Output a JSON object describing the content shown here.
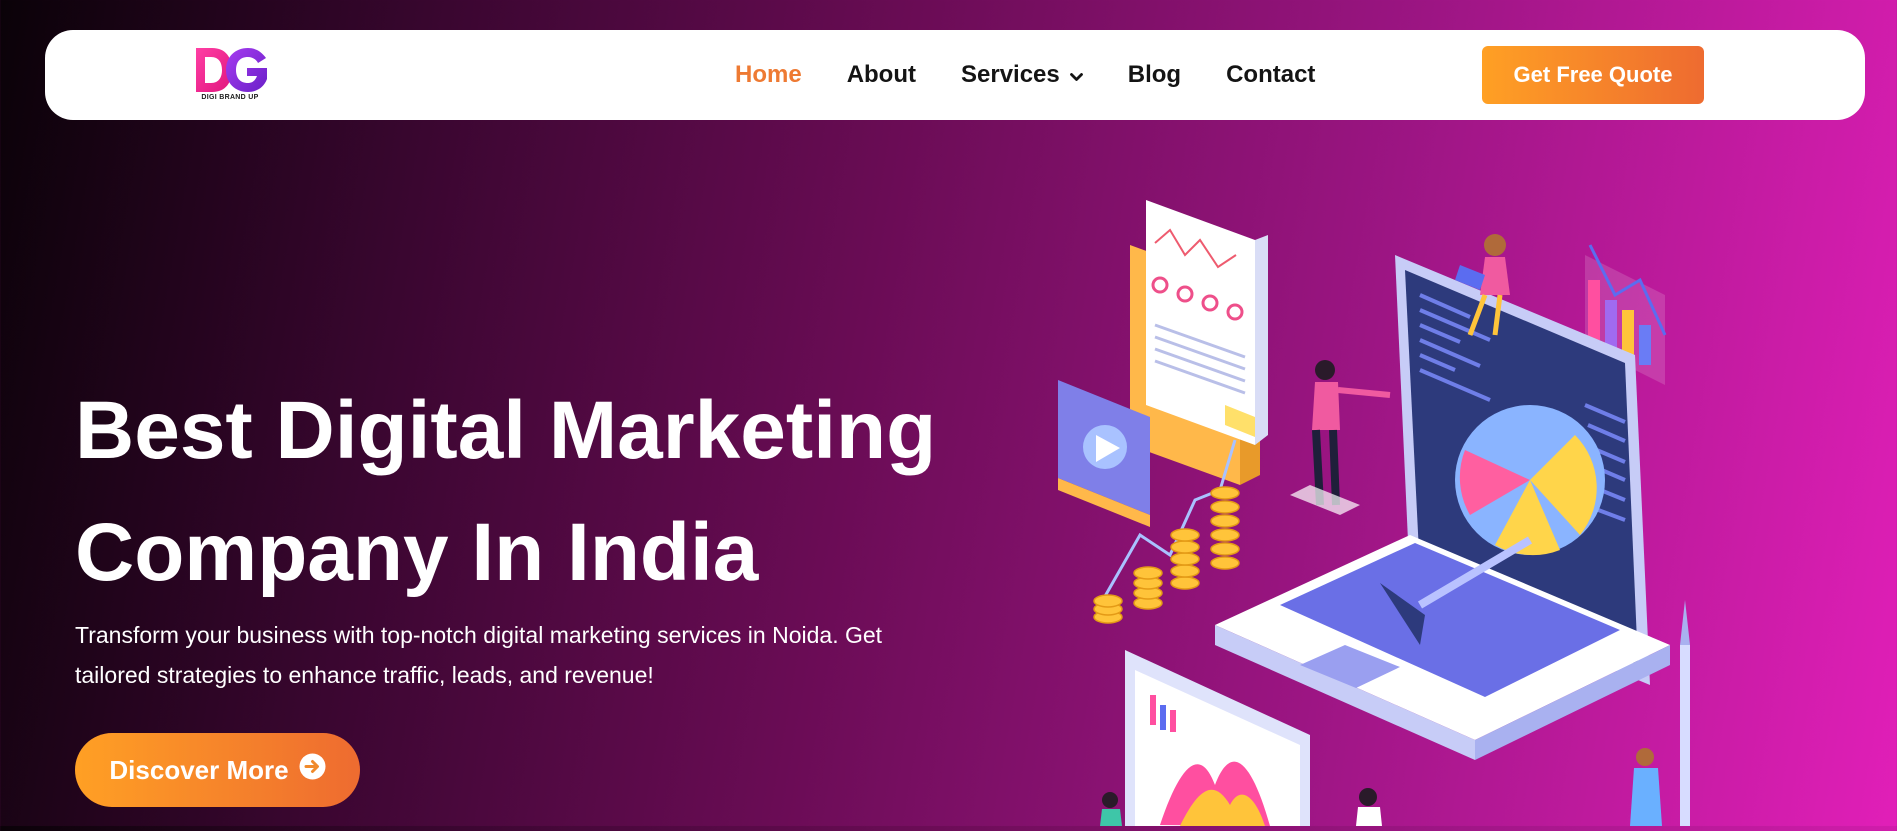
{
  "header": {
    "logo_text": "DIGI BRAND UP",
    "nav": [
      {
        "label": "Home",
        "active": true
      },
      {
        "label": "About",
        "active": false
      },
      {
        "label": "Services",
        "active": false,
        "has_dropdown": true
      },
      {
        "label": "Blog",
        "active": false
      },
      {
        "label": "Contact",
        "active": false
      }
    ],
    "cta_label": "Get Free Quote"
  },
  "hero": {
    "title_line1": "Best Digital Marketing",
    "title_line2": "Company In India",
    "description": "Transform your business with top-notch digital marketing services in Noida. Get tailored strategies to enhance traffic, leads, and revenue!",
    "button_label": "Discover More"
  },
  "icons": {
    "dropdown": "chevron-down-icon",
    "button_arrow": "arrow-circle-right-icon"
  },
  "colors": {
    "accent": "#ee7a33",
    "button_start": "#ffa024",
    "button_end": "#ee6b30",
    "bg_dark": "#0a0208",
    "bg_pink": "#e11fb8"
  }
}
